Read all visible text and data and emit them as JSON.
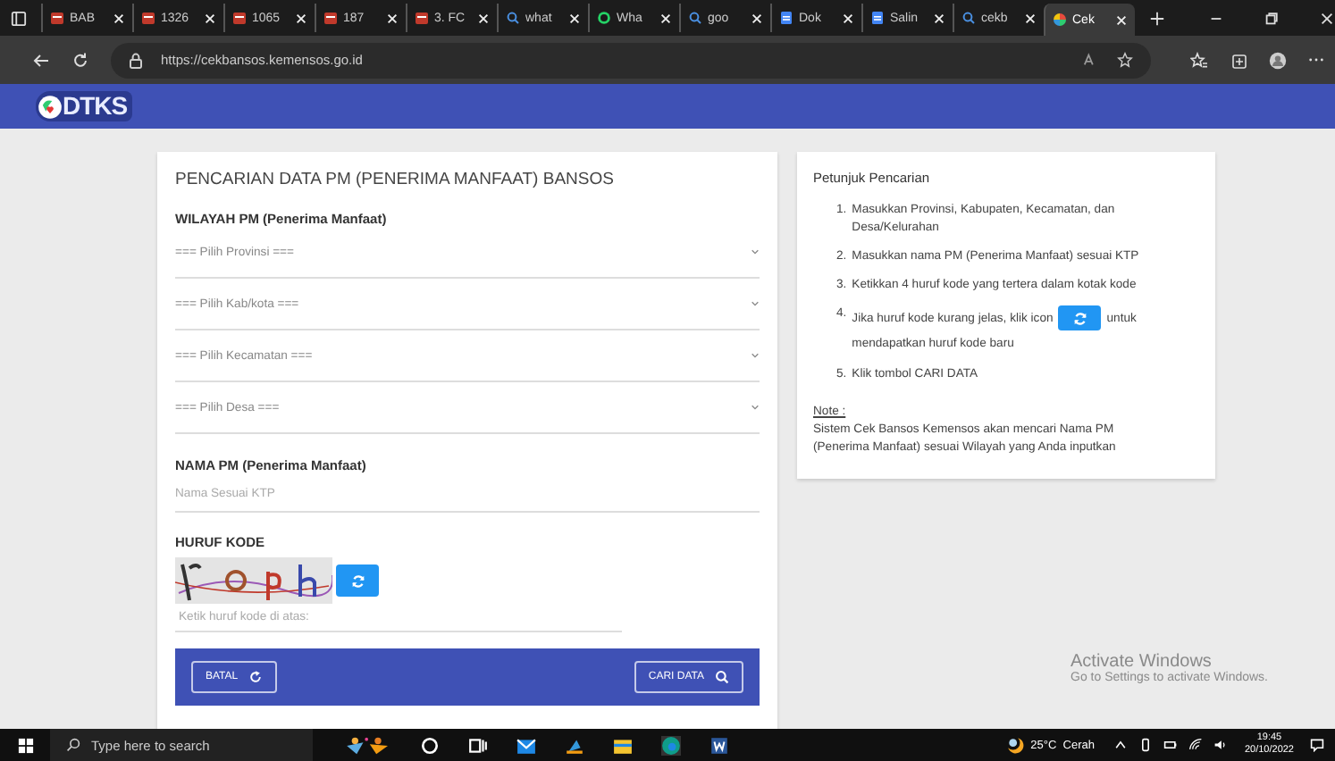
{
  "browser": {
    "tabs": [
      {
        "label": "BAB",
        "kind": "doc-red",
        "selected": false
      },
      {
        "label": "1326",
        "kind": "doc-red",
        "selected": false
      },
      {
        "label": "1065",
        "kind": "doc-red",
        "selected": false
      },
      {
        "label": "187",
        "kind": "doc-red",
        "selected": false
      },
      {
        "label": "3. FC",
        "kind": "doc-red",
        "selected": false
      },
      {
        "label": "what",
        "kind": "search",
        "selected": false
      },
      {
        "label": "Wha",
        "kind": "chat",
        "selected": false
      },
      {
        "label": "goo",
        "kind": "search",
        "selected": false
      },
      {
        "label": "Dok",
        "kind": "doc-blue",
        "selected": false
      },
      {
        "label": "Salin",
        "kind": "doc-blue",
        "selected": false
      },
      {
        "label": "cekb",
        "kind": "search",
        "selected": false
      },
      {
        "label": "Cek",
        "kind": "site",
        "selected": true
      }
    ],
    "url": "https://cekbansos.kemensos.go.id"
  },
  "header": {
    "logo": "DTKS"
  },
  "form": {
    "title": "PENCARIAN DATA PM (PENERIMA MANFAAT) BANSOS",
    "region_label": "WILAYAH PM (Penerima Manfaat)",
    "selects": [
      "=== Pilih Provinsi ===",
      "=== Pilih Kab/kota ===",
      "=== Pilih Kecamatan ===",
      "=== Pilih Desa ==="
    ],
    "name_label": "NAMA PM (Penerima Manfaat)",
    "name_placeholder": "Nama Sesuai KTP",
    "code_label": "HURUF KODE",
    "code_placeholder": "Ketik huruf kode di atas:",
    "cancel_button": "BATAL",
    "search_button": "CARI DATA"
  },
  "help": {
    "title": "Petunjuk Pencarian",
    "steps": [
      {
        "num": "1.",
        "text": "Masukkan Provinsi, Kabupaten, Kecamatan, dan Desa/Kelurahan",
        "kind": "text"
      },
      {
        "num": "2.",
        "text": "Masukkan nama PM (Penerima Manfaat) sesuai KTP",
        "kind": "text"
      },
      {
        "num": "3.",
        "text": "Ketikkan 4 huruf kode yang tertera dalam kotak kode",
        "kind": "text"
      },
      {
        "num": "4.",
        "text": "Jika huruf kode kurang jelas, klik icon",
        "after": "untuk",
        "continued": "mendapatkan huruf kode baru",
        "kind": "icon"
      },
      {
        "num": "5.",
        "text": "Klik tombol CARI DATA",
        "kind": "text"
      }
    ],
    "note_label": "Note :",
    "note": "Sistem Cek Bansos Kemensos akan mencari Nama PM (Penerima Manfaat) sesuai Wilayah yang Anda inputkan"
  },
  "watermark": {
    "title": "Activate Windows",
    "subtitle": "Go to Settings to activate Windows."
  },
  "taskbar": {
    "search_placeholder": "Type here to search",
    "weather": "25°C  Cerah",
    "time": "19:45",
    "date": "20/10/2022"
  }
}
